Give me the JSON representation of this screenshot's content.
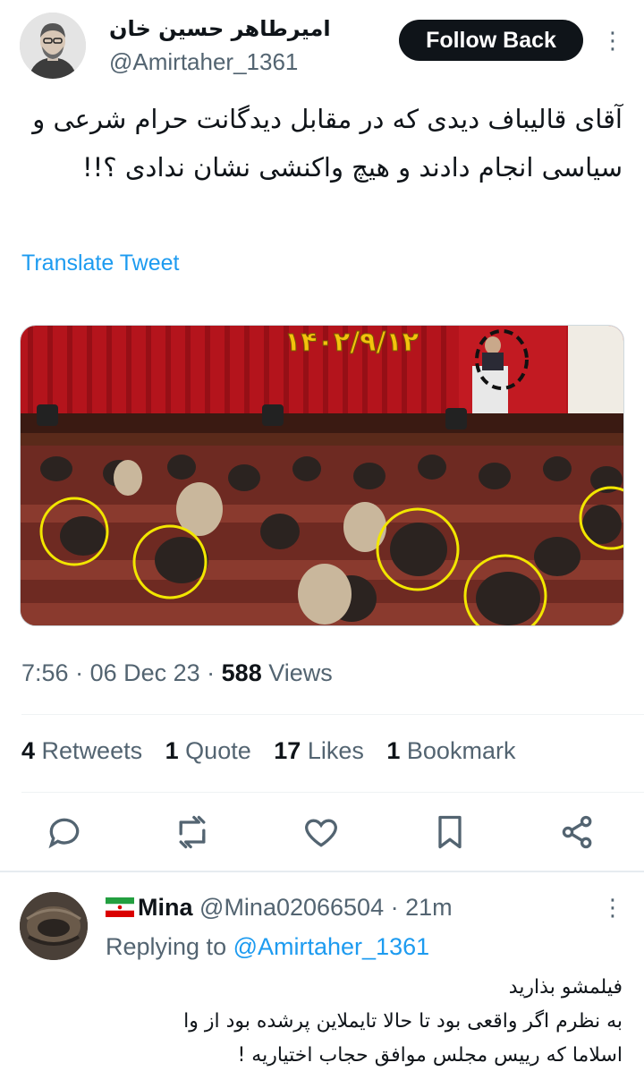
{
  "author": {
    "name": "امیرطاهر حسین خان",
    "handle": "@Amirtaher_1361"
  },
  "follow_button": {
    "label": "Follow Back"
  },
  "more_icon": "⋮",
  "tweet": {
    "text": "آقای قالیباف دیدی که در مقابل دیدگانت حرام شرعی و سیاسی انجام دادند و هیچ واکنشی نشان ندادی ؟!!",
    "translate_label": "Translate Tweet",
    "media": {
      "overlay_date": "۱۴۰۲/۹/۱۲",
      "highlight_color": "#f2e600"
    },
    "time": "7:56",
    "date": "06 Dec 23",
    "views_count": "588",
    "views_label": "Views"
  },
  "stats": [
    {
      "count": "4",
      "label": "Retweets"
    },
    {
      "count": "1",
      "label": "Quote"
    },
    {
      "count": "17",
      "label": "Likes"
    },
    {
      "count": "1",
      "label": "Bookmark"
    }
  ],
  "actions": {
    "reply_icon": "reply-icon",
    "retweet_icon": "retweet-icon",
    "like_icon": "heart-icon",
    "bookmark_icon": "bookmark-icon",
    "share_icon": "share-icon"
  },
  "reply": {
    "name": "Mina",
    "handle": "@Mina02066504",
    "time": "21m",
    "replying_label": "Replying to",
    "replying_to": "@Amirtaher_1361",
    "lines": [
      "فیلمشو بذارید",
      "به نظرم اگر واقعی بود تا حالا تایملاین پرشده بود از وا",
      "اسلاما که رییس مجلس موافق حجاب اختیاریه !"
    ]
  },
  "colors": {
    "accent": "#1d9bf0",
    "text": "#0f1419",
    "secondary": "#536471",
    "button_bg": "#0f1419"
  }
}
